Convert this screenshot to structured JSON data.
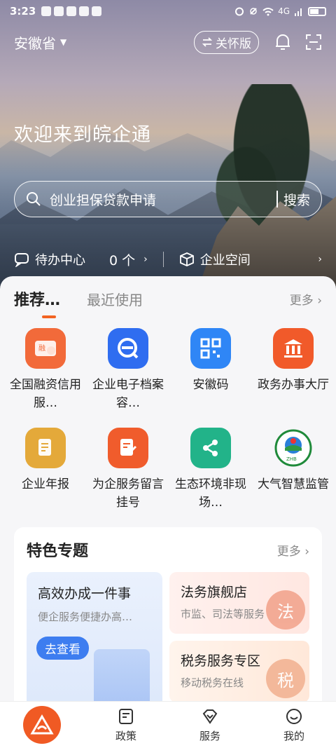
{
  "status": {
    "time": "3:23",
    "network": "4G"
  },
  "header": {
    "province": "安徽省",
    "care_mode": "关怀版"
  },
  "hero": {
    "welcome": "欢迎来到皖企通",
    "search_placeholder": "创业担保贷款申请",
    "search_button": "搜索"
  },
  "quick": {
    "todo_label": "待办中心",
    "todo_count": "0 个",
    "space_label": "企业空间"
  },
  "tabs": {
    "recommend": "推荐…",
    "recent": "最近使用",
    "more": "更多"
  },
  "services": [
    {
      "label": "全国融资信用服…",
      "color": "#f26a3a",
      "icon": "credit-card-icon"
    },
    {
      "label": "企业电子档案容…",
      "color": "#2f6df0",
      "icon": "e-archive-icon"
    },
    {
      "label": "安徽码",
      "color": "#2f86f6",
      "icon": "qr-code-icon"
    },
    {
      "label": "政务办事大厅",
      "color": "#f15a2a",
      "icon": "government-hall-icon"
    },
    {
      "label": "企业年报",
      "color": "#e4a93a",
      "icon": "annual-report-icon"
    },
    {
      "label": "为企服务留言挂号",
      "color": "#f05c2c",
      "icon": "message-edit-icon"
    },
    {
      "label": "生态环境非现场…",
      "color": "#22b389",
      "icon": "share-nodes-icon"
    },
    {
      "label": "大气智慧监管",
      "color": "#ffffff",
      "icon": "zhb-logo-icon"
    }
  ],
  "feature": {
    "title": "特色专题",
    "more": "更多",
    "big_card": {
      "title": "高效办成一件事",
      "subtitle": "便企服务便捷办高…",
      "button": "去查看"
    },
    "card_law": {
      "title": "法务旗舰店",
      "subtitle": "市监、司法等服务",
      "seal": "法",
      "seal_color": "#f2a189"
    },
    "card_tax": {
      "title": "税务服务专区",
      "subtitle": "移动税务在线",
      "seal": "税",
      "seal_color": "#f2b08f"
    }
  },
  "bottom_nav": {
    "policy": "政策",
    "service": "服务",
    "mine": "我的"
  },
  "colors": {
    "accent": "#f05a24",
    "link_blue": "#3d7df0"
  }
}
